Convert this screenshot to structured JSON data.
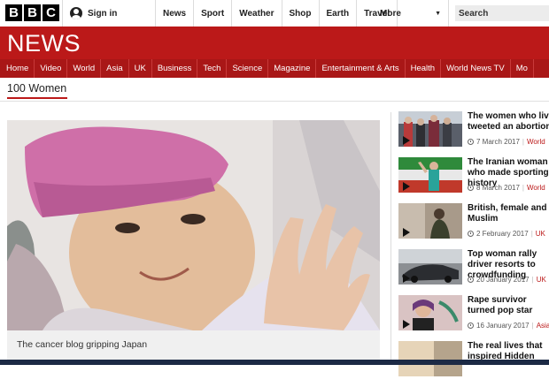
{
  "brand": {
    "logo_letters": [
      "B",
      "B",
      "C"
    ]
  },
  "topbar": {
    "signin_label": "Sign in",
    "nav": [
      "News",
      "Sport",
      "Weather",
      "Shop",
      "Earth",
      "Travel"
    ],
    "more_label": "More",
    "search_placeholder": "Search"
  },
  "header": {
    "title": "NEWS"
  },
  "nav": [
    "Home",
    "Video",
    "World",
    "Asia",
    "UK",
    "Business",
    "Tech",
    "Science",
    "Magazine",
    "Entertainment & Arts",
    "Health",
    "World News TV",
    "Mo"
  ],
  "section": {
    "title": "100 Women"
  },
  "main_story": {
    "caption": "The cancer blog gripping Japan"
  },
  "side_stories": [
    {
      "title": "The women who live tweeted an abortion",
      "date": "7 March 2017",
      "tag": "World"
    },
    {
      "title": "The Iranian woman who made sporting history",
      "date": "8 March 2017",
      "tag": "World"
    },
    {
      "title": "British, female and Muslim",
      "date": "2 February 2017",
      "tag": "UK"
    },
    {
      "title": "Top woman rally driver resorts to crowdfunding",
      "date": "20 January 2017",
      "tag": "UK"
    },
    {
      "title": "Rape survivor turned pop star",
      "date": "16 January 2017",
      "tag": "Asia"
    },
    {
      "title": "The real lives that inspired Hidden",
      "date": "",
      "tag": ""
    }
  ],
  "colors": {
    "brand_red": "#bb1919",
    "nav_red": "#a91717",
    "text": "#222222"
  }
}
